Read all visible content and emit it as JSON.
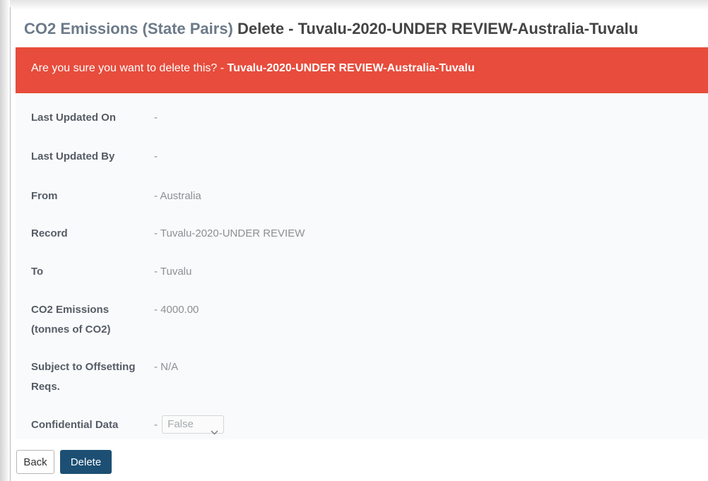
{
  "header": {
    "title_entity": "CO2 Emissions (State Pairs)",
    "title_action": "Delete - Tuvalu-2020-UNDER REVIEW-Australia-Tuvalu"
  },
  "alert": {
    "question": "Are you sure you want to delete this? - ",
    "record_name": "Tuvalu-2020-UNDER REVIEW-Australia-Tuvalu",
    "color": "#e74c3c"
  },
  "fields": {
    "last_updated_on": {
      "label": "Last Updated On",
      "value": "-"
    },
    "last_updated_by": {
      "label": "Last Updated By",
      "value": "-"
    },
    "from": {
      "label": "From",
      "value": "- Australia"
    },
    "record": {
      "label": "Record",
      "value": "- Tuvalu-2020-UNDER REVIEW"
    },
    "to": {
      "label": "To",
      "value": "- Tuvalu"
    },
    "co2_emissions": {
      "label_line1": "CO2 Emissions",
      "label_line2": "(tonnes of CO2)",
      "value": "- 4000.00"
    },
    "subject_to_offsetting": {
      "label_line1": "Subject to Offsetting",
      "label_line2": "Reqs.",
      "value": "- N/A"
    },
    "confidential_data": {
      "label": "Confidential Data",
      "prefix": "-",
      "select_value": "False",
      "select_icon": "chevron-down-icon"
    }
  },
  "actions": {
    "back_label": "Back",
    "delete_label": "Delete",
    "delete_color": "#1c4f73"
  }
}
